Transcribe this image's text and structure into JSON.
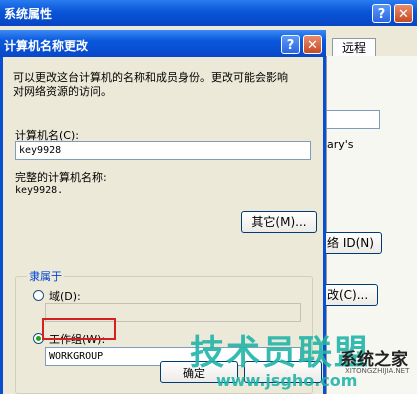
{
  "back_window": {
    "title": "系统属性",
    "tab_remote": "远程",
    "partial_text_1": "ary's",
    "id_button": "络 ID(N)",
    "change_button": "改(C)..."
  },
  "dialog": {
    "title": "计算机名称更改",
    "description_line1": "可以更改这台计算机的名称和成员身份。更改可能会影响",
    "description_line2": "对网络资源的访问。",
    "computer_name_label": "计算机名(C):",
    "computer_name_value": "key9928",
    "full_name_label": "完整的计算机名称:",
    "full_name_value": "key9928.",
    "more_button": "其它(M)...",
    "member_of_label": "隶属于",
    "domain_label": "域(D):",
    "domain_value": "",
    "workgroup_label": "工作组(W):",
    "workgroup_value": "WORKGROUP",
    "ok_button": "确定"
  },
  "watermark": {
    "big_text": "技术员联盟",
    "url": "www.jsgho.com",
    "site_name": "系统之家",
    "site_en": "XITONGZHIJIA.NET"
  }
}
